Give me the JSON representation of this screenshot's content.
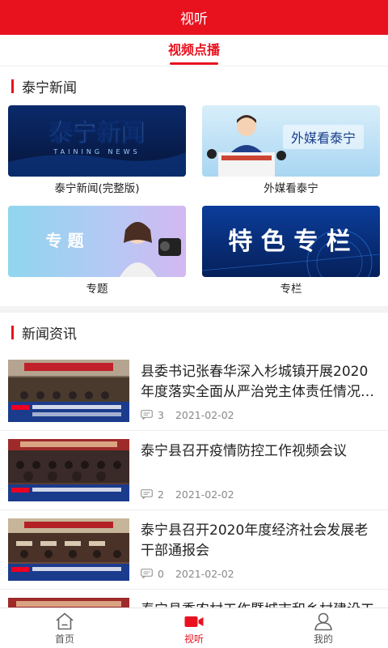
{
  "header": {
    "title": "视听"
  },
  "tabs": [
    {
      "label": "视频点播",
      "active": true
    }
  ],
  "sections": {
    "video": {
      "title": "泰宁新闻",
      "items": [
        {
          "caption": "泰宁新闻(完整版)",
          "thumb_text": "泰宁新闻",
          "thumb_sub": "TAINING NEWS"
        },
        {
          "caption": "外媒看泰宁",
          "thumb_text": "外媒看泰宁"
        },
        {
          "caption": "专题",
          "thumb_text": "专 题"
        },
        {
          "caption": "专栏",
          "thumb_text": "特 色 专 栏"
        }
      ]
    },
    "news": {
      "title": "新闻资讯",
      "items": [
        {
          "title": "县委书记张春华深入杉城镇开展2020年度落实全面从严治党主体责任情况检查",
          "comments": "3",
          "date": "2021-02-02"
        },
        {
          "title": "泰宁县召开疫情防控工作视频会议",
          "comments": "2",
          "date": "2021-02-02"
        },
        {
          "title": "泰宁县召开2020年度经济社会发展老干部通报会",
          "comments": "0",
          "date": "2021-02-02"
        },
        {
          "title": "泰宁县委农村工作暨城市和乡村建设工作会议召开",
          "comments": "",
          "date": ""
        }
      ]
    }
  },
  "bottom_nav": [
    {
      "label": "首页",
      "icon": "home-icon"
    },
    {
      "label": "视听",
      "icon": "video-icon",
      "active": true
    },
    {
      "label": "我的",
      "icon": "user-icon"
    }
  ],
  "colors": {
    "accent": "#e8121f"
  }
}
